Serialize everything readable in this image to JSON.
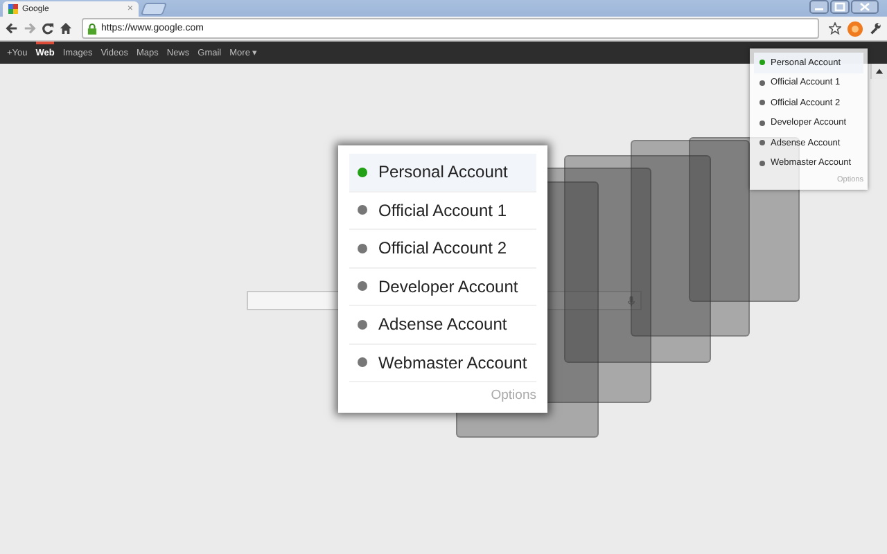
{
  "window": {
    "tab_title": "Google",
    "tab_close": "×"
  },
  "address_bar": {
    "url": "https://www.google.com"
  },
  "google_bar": {
    "links": [
      {
        "label": "+You",
        "selected": false
      },
      {
        "label": "Web",
        "selected": true
      },
      {
        "label": "Images",
        "selected": false
      },
      {
        "label": "Videos",
        "selected": false
      },
      {
        "label": "Maps",
        "selected": false
      },
      {
        "label": "News",
        "selected": false
      },
      {
        "label": "Gmail",
        "selected": false
      },
      {
        "label": "More ▾",
        "selected": false
      }
    ]
  },
  "popup": {
    "accounts": [
      {
        "name": "Personal Account",
        "selected": true
      },
      {
        "name": "Official Account 1",
        "selected": false
      },
      {
        "name": "Official Account 2",
        "selected": false
      },
      {
        "name": "Developer Account",
        "selected": false
      },
      {
        "name": "Adsense Account",
        "selected": false
      },
      {
        "name": "Webmaster Account",
        "selected": false
      }
    ],
    "options": "Options"
  },
  "enlarged_menu": {
    "accounts": [
      {
        "name": "Personal Account",
        "selected": true
      },
      {
        "name": "Official Account 1",
        "selected": false
      },
      {
        "name": "Official Account 2",
        "selected": false
      },
      {
        "name": "Developer Account",
        "selected": false
      },
      {
        "name": "Adsense Account",
        "selected": false
      },
      {
        "name": "Webmaster Account",
        "selected": false
      }
    ],
    "options": "Options"
  }
}
